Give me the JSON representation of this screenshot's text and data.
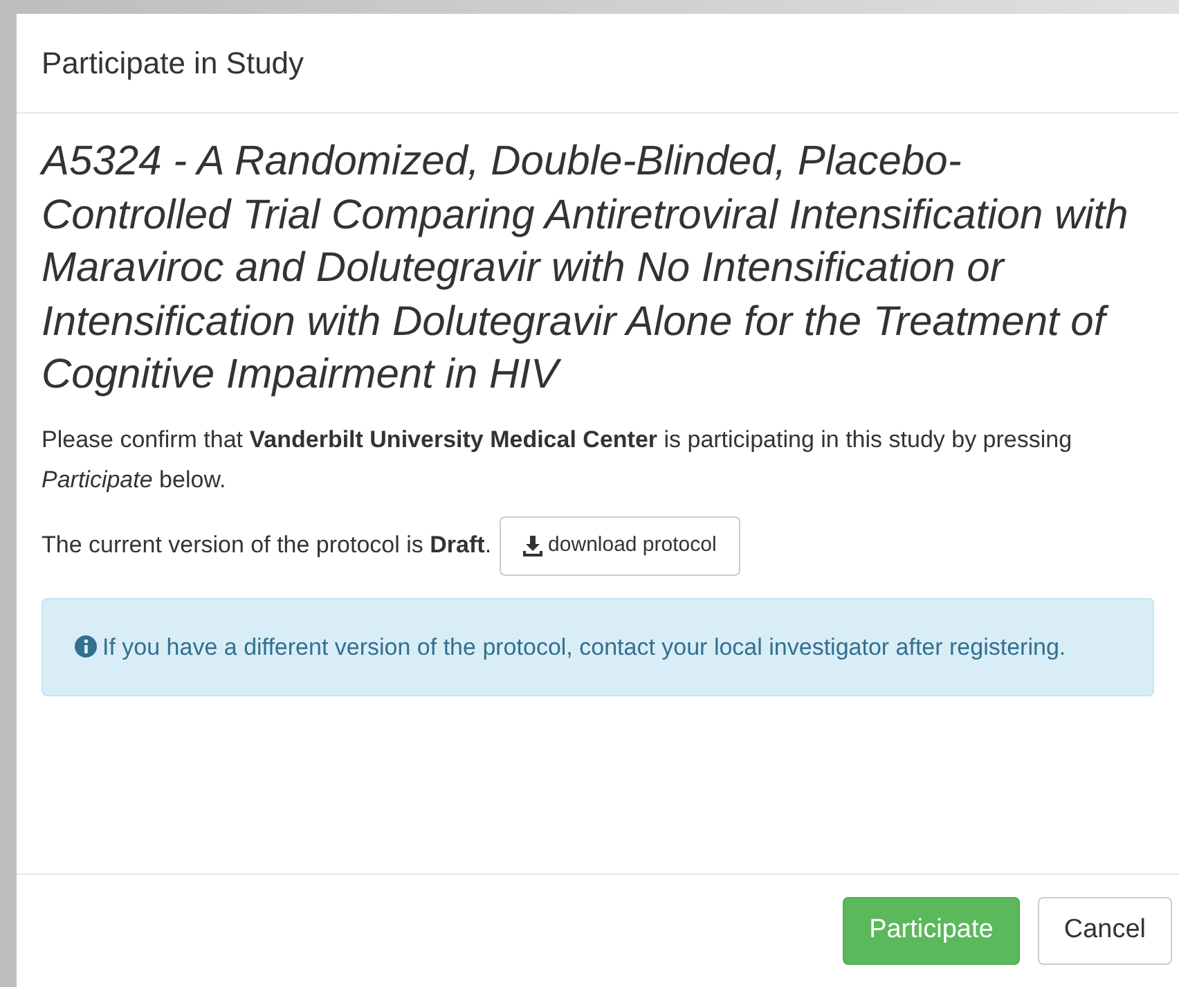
{
  "dialog": {
    "title": "Participate in Study"
  },
  "study_title": "A5324 - A Randomized, Double-Blinded, Placebo-Controlled Trial Comparing Antiretroviral Intensification with Maraviroc and Dolutegravir with No Intensification or Intensification with Dolutegravir Alone for the Treatment of Cognitive Impairment in HIV",
  "confirm_text": "Please confirm that **Vanderbilt University Medical Center** is participating in this study by pressing *Participate* below.",
  "version_text": "The current version of the protocol is **Draft**.",
  "download_button": "download protocol",
  "info_alert": "If you have a different version of the protocol, contact your local investigator after registering.",
  "buttons": [
    {
      "label": "Participate",
      "kind": "primary"
    },
    {
      "label": "Cancel",
      "kind": "default"
    }
  ]
}
